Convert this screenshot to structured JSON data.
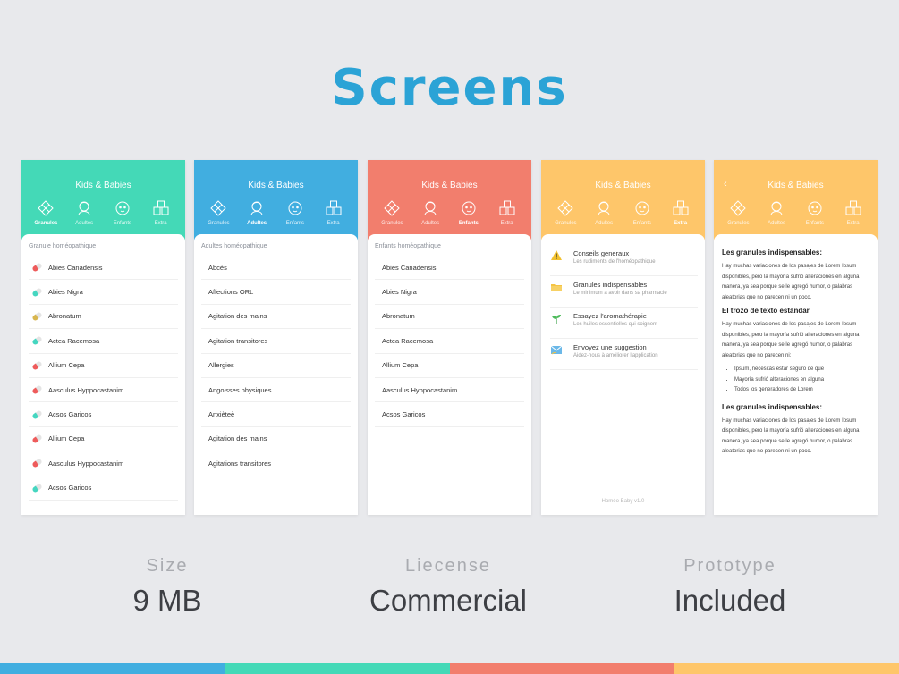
{
  "title": "Screens",
  "colors": {
    "title": "#2ba3d6",
    "green": "#44d9b7",
    "blue": "#41aee0",
    "salmon": "#f27e6d",
    "orange": "#fec66a"
  },
  "app_title": "Kids & Babies",
  "tabs": [
    "Granules",
    "Adultes",
    "Enfants",
    "Extra"
  ],
  "screen1": {
    "section": "Granule homéopathique",
    "items": [
      "Abies Canadensis",
      "Abies Nigra",
      "Abronatum",
      "Actea Racemosa",
      "Allium Cepa",
      "Aasculus Hyppocastanim",
      "Acsos Garicos",
      "Allium Cepa",
      "Aasculus Hyppocastanim",
      "Acsos Garicos"
    ],
    "pill_colors": [
      "#ee5b5b",
      "#45d6c0",
      "#d8b64f",
      "#45d6c0",
      "#ee5b5b",
      "#ee5b5b",
      "#45d6c0",
      "#ee5b5b",
      "#ee5b5b",
      "#45d6c0"
    ]
  },
  "screen2": {
    "section": "Adultes homéopathique",
    "items": [
      "Abcès",
      "Affections ORL",
      "Agitation des mains",
      "Agitation transitores",
      "Allergies",
      "Angoisses physiques",
      "Anxièteè",
      "Agitation des mains",
      "Agitations transitores"
    ]
  },
  "screen3": {
    "section": "Enfants homéopathique",
    "items": [
      "Abies Canadensis",
      "Abies Nigra",
      "Abronatum",
      "Actea Racemosa",
      "Allium Cepa",
      "Aasculus Hyppocastanim",
      "Acsos Garicos"
    ]
  },
  "screen4": {
    "items": [
      {
        "title": "Conseils generaux",
        "sub": "Les rudiments de l'homéopathique",
        "icon": "warning-icon"
      },
      {
        "title": "Granules indispensables",
        "sub": "Le minimum a avoir dans sa pharmacie",
        "icon": "folder-icon"
      },
      {
        "title": "Essayez l'aromathérapie",
        "sub": "Les huiles essentielles qui soignent",
        "icon": "sprout-icon"
      },
      {
        "title": "Envoyez une suggestion",
        "sub": "Aidez-nous à améliorer l'application",
        "icon": "mail-icon"
      }
    ],
    "version": "Homéo Baby v1.0"
  },
  "screen5": {
    "back": "‹",
    "h1": "Les granules indispensables:",
    "p1": "Hay muchas variaciones de los pasajes de Lorem Ipsum disponibles, pero la mayoría sufrió alteraciones en alguna manera, ya sea porque se le agregó humor, o palabras aleatorias que no parecen ni un poco.",
    "h2": "El trozo de texto estándar",
    "p2": "Hay muchas variaciones de los pasajes de Lorem Ipsum disponibles, pero la mayoría sufrió alteraciones en alguna manera, ya sea porque se le agregó humor, o palabras aleatorias que no parecen ni:",
    "bullets": [
      "Ipsum, necesitás estar seguro de que",
      "Mayoría sufrió alteraciones en alguna",
      "Todos los generadores de Lorem"
    ],
    "h3": "Les granules indispensables:",
    "p3": "Hay muchas variaciones de los pasajes de Lorem Ipsum disponibles, pero la mayoría sufrió alteraciones en alguna manera, ya sea porque se le agregó humor, o palabras aleatorias que no parecen ni un poco."
  },
  "stats": [
    {
      "label": "Size",
      "value": "9 MB"
    },
    {
      "label": "Liecense",
      "value": "Commercial"
    },
    {
      "label": "Prototype",
      "value": "Included"
    }
  ]
}
